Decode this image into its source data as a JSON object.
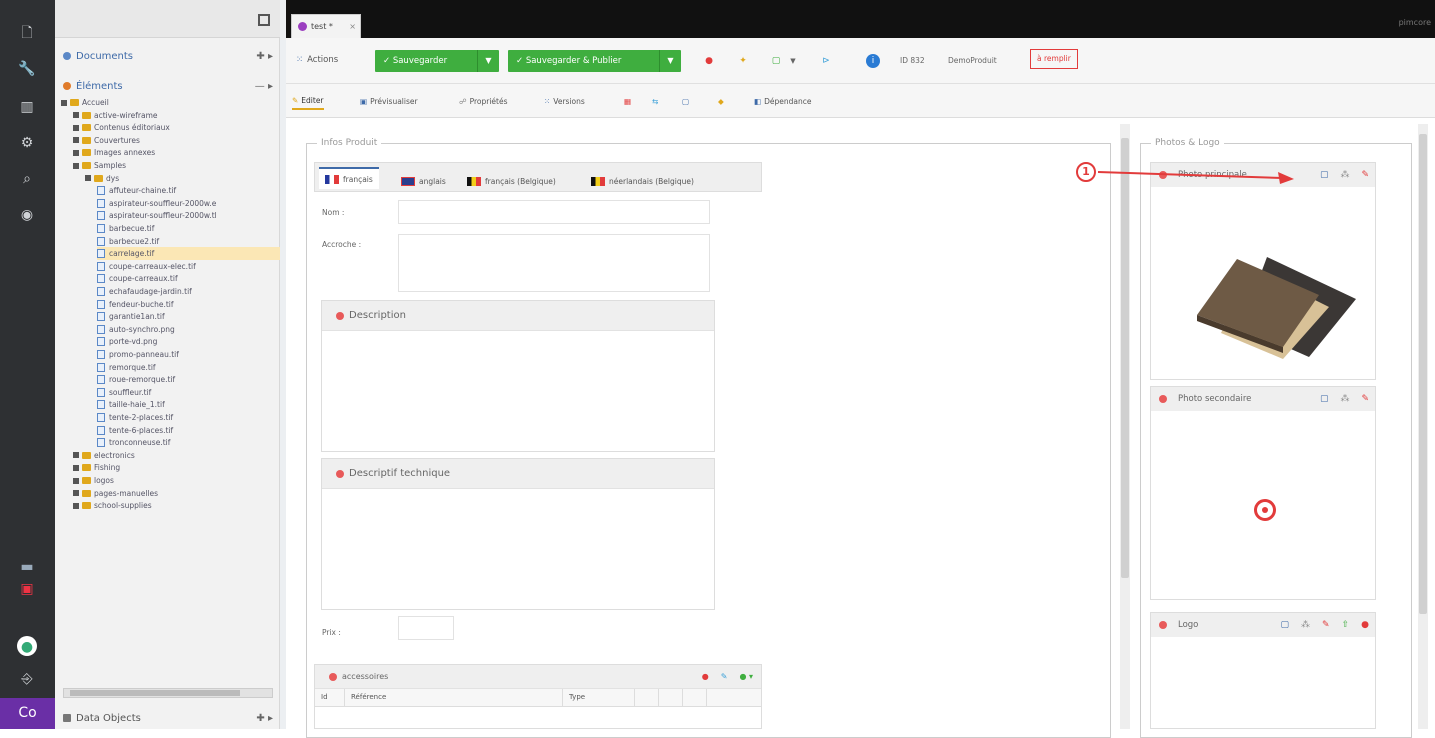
{
  "rail": {
    "icons": [
      "file-icon",
      "wrench-icon",
      "chart-icon",
      "gear-icon",
      "search-icon",
      "eye-icon",
      "calendar-icon",
      "alert-icon",
      "pimcore-icon",
      "logout-icon",
      "co-icon"
    ]
  },
  "tree": {
    "documents_label": "Documents",
    "elements_label": "Éléments",
    "dataobjects_label": "Data Objects",
    "tools_doc": "✚ ▸",
    "tools_el": "— ▸",
    "tools_do": "✚ ▸",
    "root": "Accueil",
    "folders_top": [
      "active-wireframe",
      "Contenus éditoriaux",
      "Couvertures",
      "Images annexes",
      "Samples"
    ],
    "subfolder": "dys",
    "files": [
      "affuteur-chaine.tif",
      "aspirateur-souffleur-2000w.e",
      "aspirateur-souffleur-2000w.tl",
      "barbecue.tif",
      "barbecue2.tif",
      "carrelage.tif",
      "coupe-carreaux-elec.tif",
      "coupe-carreaux.tif",
      "echafaudage-jardin.tif",
      "fendeur-buche.tif",
      "garantie1an.tif",
      "auto-synchro.png",
      "porte-vd.png",
      "promo-panneau.tif",
      "remorque.tif",
      "roue-remorque.tif",
      "souffleur.tif",
      "taille-haie_1.tif",
      "tente-2-places.tif",
      "tente-6-places.tif",
      "tronconneuse.tif"
    ],
    "folders_bottom": [
      "electronics",
      "Fishing",
      "logos",
      "pages-manuelles",
      "school-supplies"
    ]
  },
  "doc_tab": "test *",
  "brand": "pimcore",
  "toolbar": {
    "actions": "Actions",
    "save": "Sauvegarder",
    "save_publish": "Sauvegarder & Publier",
    "id": "ID 832",
    "class": "DemoProduit",
    "sample": "à remplir"
  },
  "subtabs": [
    "Editer",
    "Prévisualiser",
    "Propriétés",
    "Versions",
    "",
    "",
    "",
    "",
    "Dépendance"
  ],
  "form": {
    "legend": "Infos Produit",
    "langs": [
      "français",
      "anglais",
      "français (Belgique)",
      "néerlandais (Belgique)"
    ],
    "nom": "Nom :",
    "accroche": "Accroche :",
    "description": "Description",
    "descriptif": "Descriptif technique",
    "prix": "Prix :",
    "accessoires": "accessoires",
    "cols": [
      "Id",
      "Référence",
      "Type"
    ]
  },
  "photos": {
    "legend": "Photos & Logo",
    "principale": "Photo principale",
    "secondaire": "Photo secondaire",
    "logo": "Logo",
    "callout": "1"
  },
  "colors": {
    "green": "#3fae3f",
    "red": "#e23b3b",
    "accent": "#3e6aa8"
  }
}
